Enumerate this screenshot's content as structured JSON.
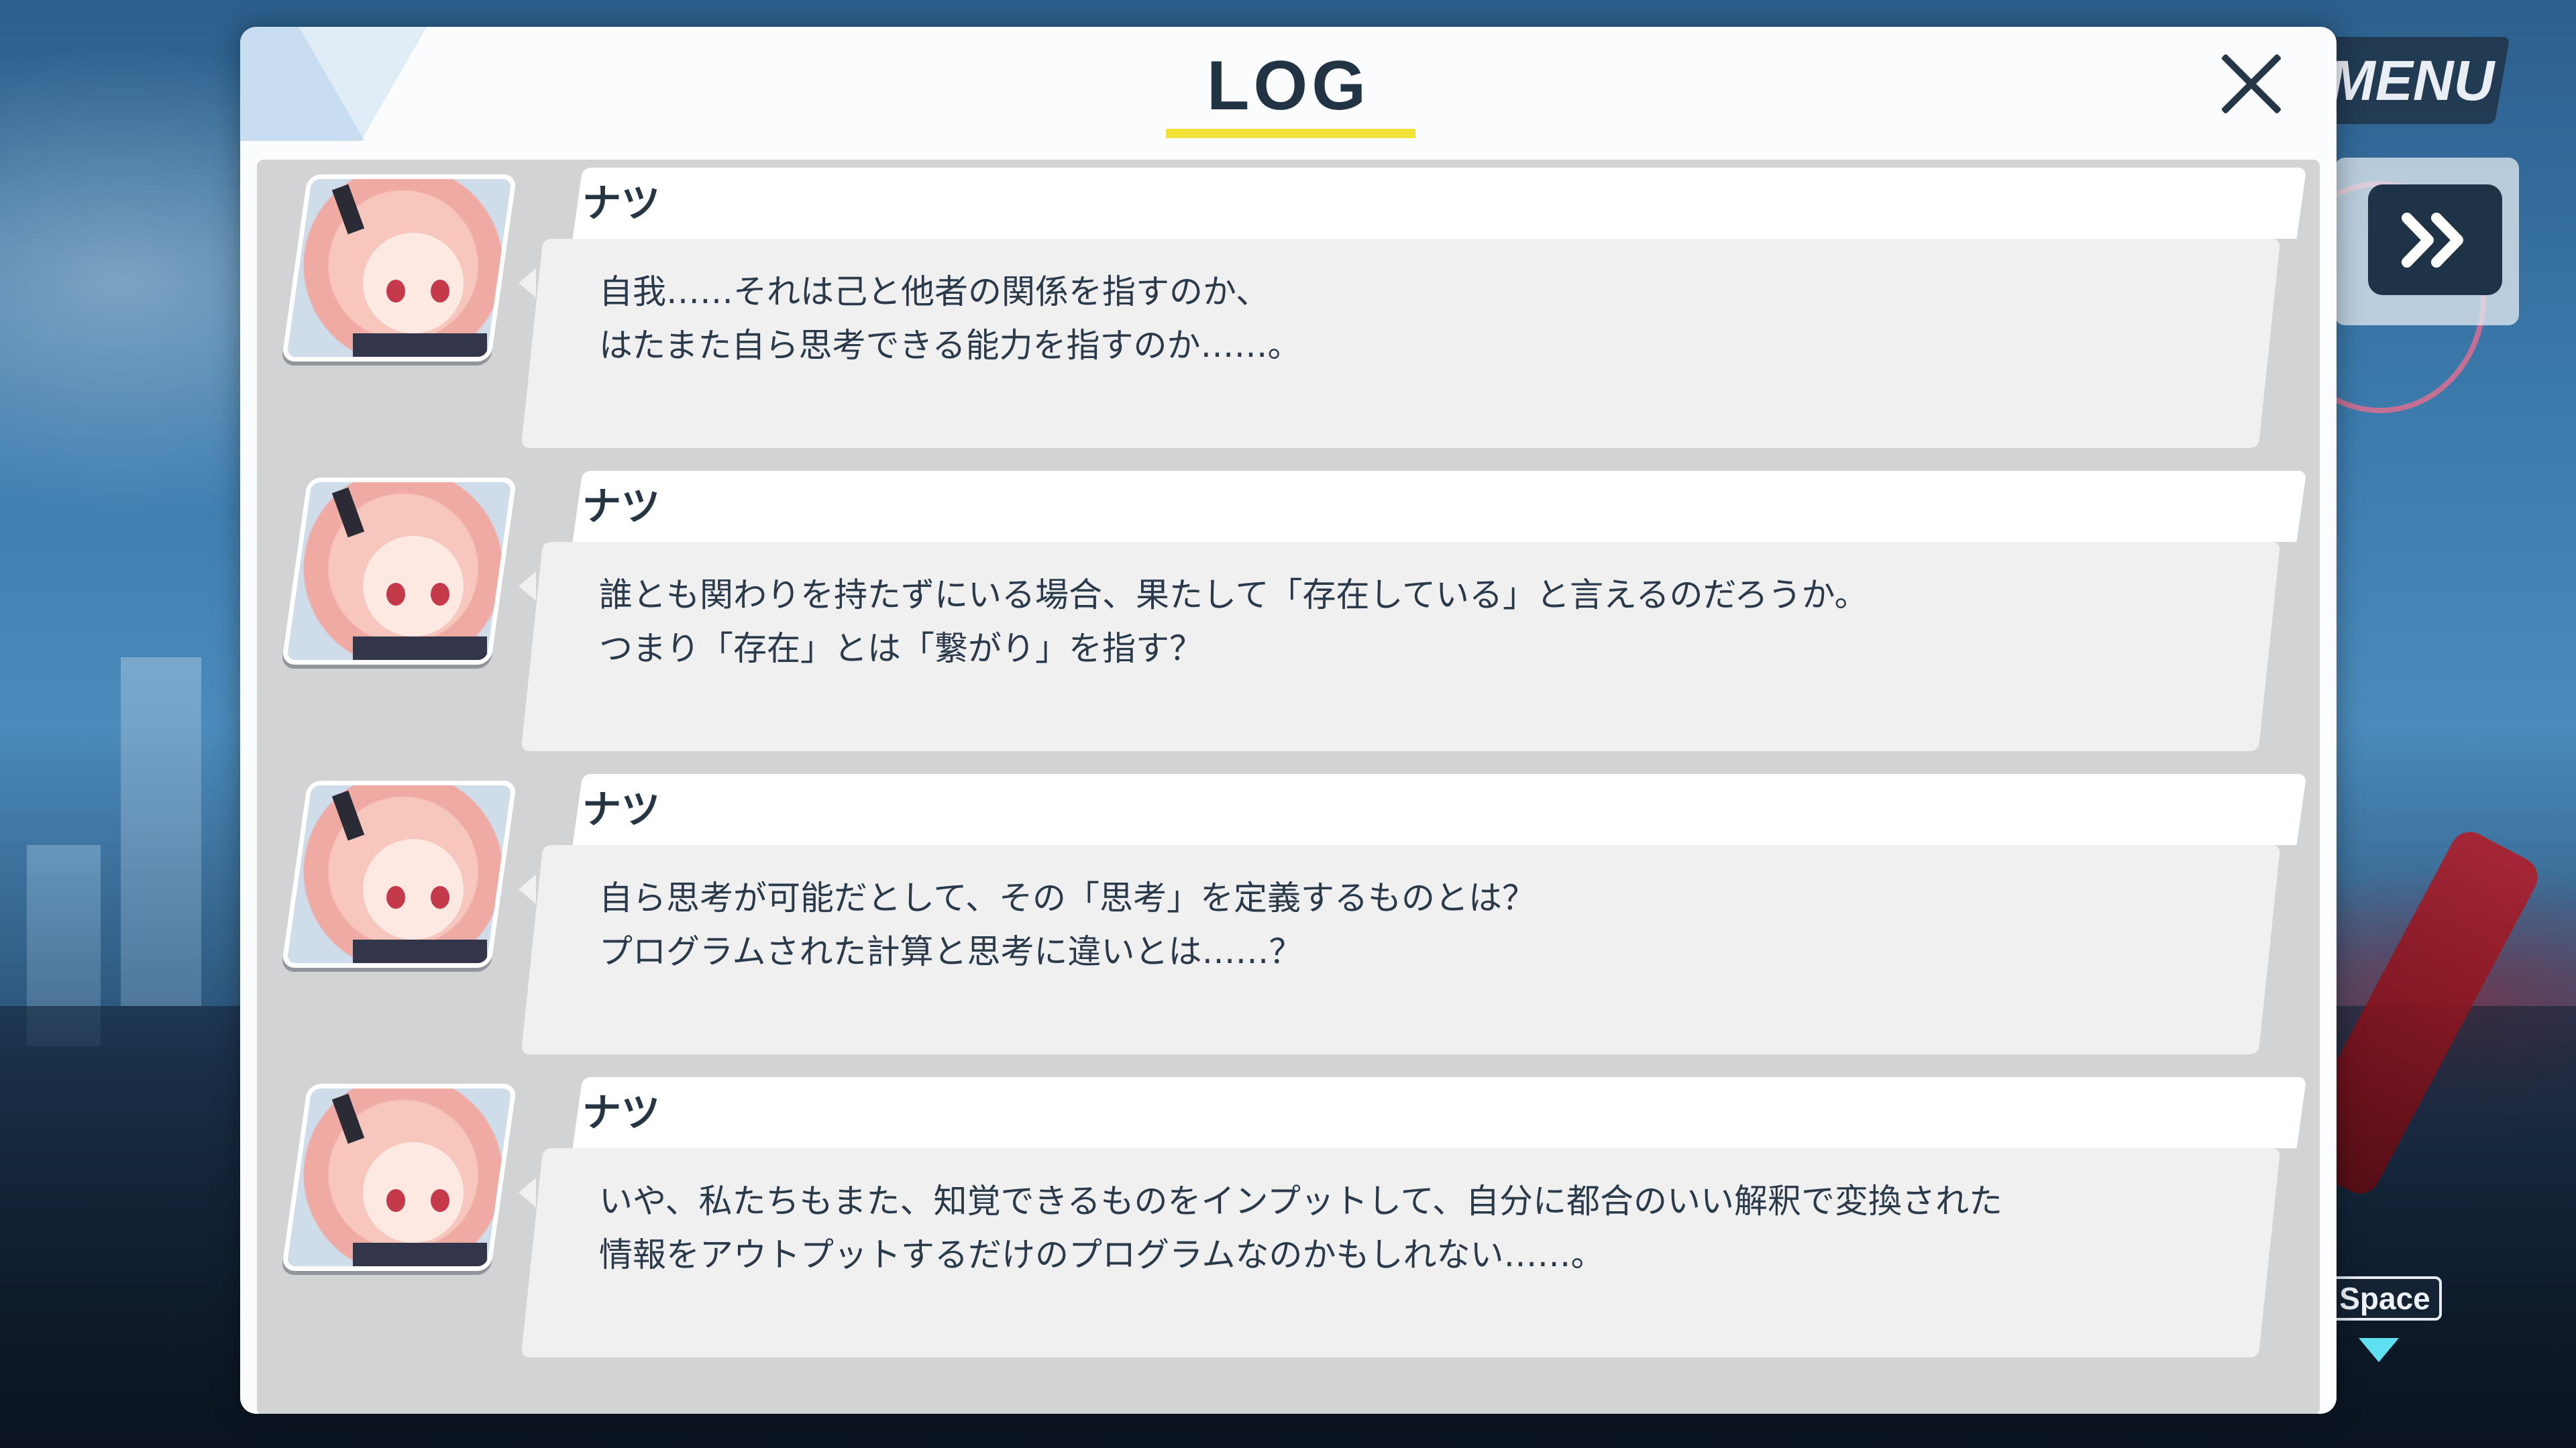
{
  "log": {
    "title": "LOG",
    "close_icon": "close-icon",
    "entries": [
      {
        "speaker": "ナツ",
        "lines": [
          "自我……それは己と他者の関係を指すのか、",
          "はたまた自ら思考できる能力を指すのか……。"
        ]
      },
      {
        "speaker": "ナツ",
        "lines": [
          "誰とも関わりを持たずにいる場合、果たして「存在している」と言えるのだろうか。",
          "つまり「存在」とは「繋がり」を指す？"
        ]
      },
      {
        "speaker": "ナツ",
        "lines": [
          "自ら思考が可能だとして、その「思考」を定義するものとは？",
          "プログラムされた計算と思考に違いとは……？"
        ]
      },
      {
        "speaker": "ナツ",
        "lines": [
          "いや、私たちもまた、知覚できるものをインプットして、自分に都合のいい解釈で変換された",
          "情報をアウトプットするだけのプログラムなのかもしれない……。"
        ]
      }
    ]
  },
  "hud": {
    "menu_label": "MENU",
    "fast_forward_icon": "fast-forward-icon",
    "space_label": "Space"
  },
  "colors": {
    "title_underline": "#f3e23a",
    "title_text": "#223344",
    "speaker_text": "#263544",
    "space_arrow": "#5ee0f0"
  }
}
